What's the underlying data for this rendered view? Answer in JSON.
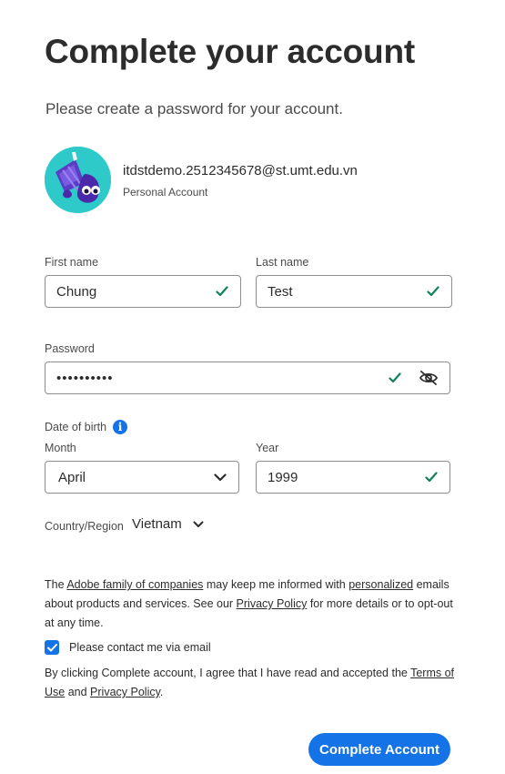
{
  "page": {
    "title": "Complete your account",
    "subtitle": "Please create a password for your account."
  },
  "account": {
    "email": "itdstdemo.2512345678@st.umt.edu.vn",
    "type": "Personal Account",
    "avatar_icon": "ink-drop-character-avatar"
  },
  "form": {
    "first_name": {
      "label": "First name",
      "value": "Chung",
      "valid": true
    },
    "last_name": {
      "label": "Last name",
      "value": "Test",
      "valid": true
    },
    "password": {
      "label": "Password",
      "value": "••••••••••",
      "valid": true,
      "visibility_icon": "eye-off-icon"
    },
    "dob": {
      "label": "Date of birth",
      "month": {
        "label": "Month",
        "value": "April"
      },
      "year": {
        "label": "Year",
        "value": "1999",
        "valid": true
      }
    },
    "country": {
      "label": "Country/Region",
      "value": "Vietnam"
    }
  },
  "legal": {
    "p1_a": "The ",
    "p1_link1": "Adobe family of companies",
    "p1_b": " may keep me informed with ",
    "p1_link2": "personalized",
    "p1_c": " emails about products and services. See our ",
    "p1_link3": "Privacy Policy",
    "p1_d": " for more details or to opt-out at any time.",
    "contact_label": "Please contact me via email",
    "contact_checked": true,
    "p2_a": "By clicking Complete account, I agree that I have read and accepted the ",
    "p2_link1": "Terms of Use",
    "p2_b": " and ",
    "p2_link2": "Privacy Policy",
    "p2_c": "."
  },
  "actions": {
    "submit_label": "Complete Account"
  },
  "colors": {
    "accent": "#1473e6",
    "valid": "#12805c",
    "avatar_bg": "#2ec9c9"
  }
}
